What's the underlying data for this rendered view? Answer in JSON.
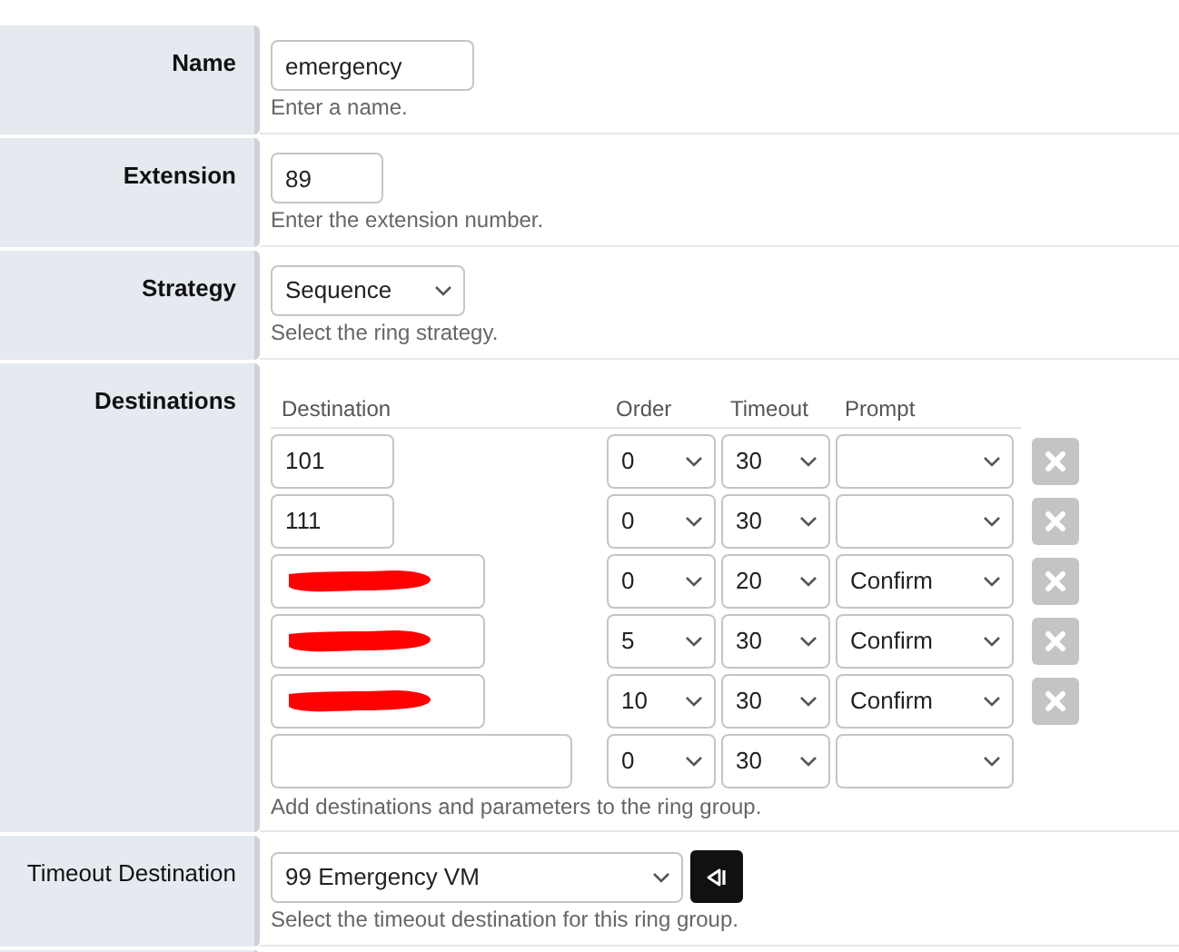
{
  "fields": [
    {
      "kind": "text",
      "label": "Name",
      "bold": true,
      "value": "emergency",
      "hint": "Enter a name."
    },
    {
      "kind": "text",
      "label": "Extension",
      "bold": true,
      "value": "89",
      "hint": "Enter the extension number."
    },
    {
      "kind": "select",
      "label": "Strategy",
      "bold": true,
      "value": "Sequence",
      "hint": "Select the ring strategy."
    },
    {
      "kind": "destinations",
      "label": "Destinations",
      "bold": true,
      "columns": [
        "Destination",
        "Order",
        "Timeout",
        "Prompt"
      ],
      "rows": [
        {
          "destination": "101",
          "redacted": false,
          "order": "0",
          "timeout": "30",
          "prompt": "",
          "deletable": true
        },
        {
          "destination": "111",
          "redacted": false,
          "order": "0",
          "timeout": "30",
          "prompt": "",
          "deletable": true
        },
        {
          "redacted": true,
          "order": "0",
          "timeout": "20",
          "prompt": "Confirm",
          "deletable": true
        },
        {
          "redacted": true,
          "order": "5",
          "timeout": "30",
          "prompt": "Confirm",
          "deletable": true
        },
        {
          "redacted": true,
          "order": "10",
          "timeout": "30",
          "prompt": "Confirm",
          "deletable": true
        },
        {
          "redacted": false,
          "order": "0",
          "timeout": "30",
          "prompt": "",
          "deletable": false
        }
      ],
      "hint": "Add destinations and parameters to the ring group."
    },
    {
      "kind": "destination_select",
      "label": "Timeout Destination",
      "bold": false,
      "value": "99 Emergency VM",
      "hint": "Select the timeout destination for this ring group."
    }
  ]
}
